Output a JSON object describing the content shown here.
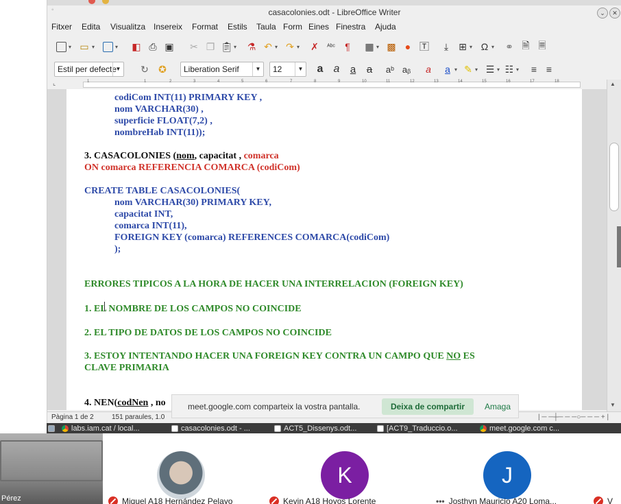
{
  "window": {
    "title": "casacolonies.odt - LibreOffice Writer"
  },
  "menu": [
    "Fitxer",
    "Edita",
    "Visualitza",
    "Insereix",
    "Format",
    "Estils",
    "Taula",
    "Form",
    "Eines",
    "Finestra",
    "Ajuda"
  ],
  "toolbar2": {
    "paragraph_style": "Estil per defecte",
    "font_name": "Liberation Serif",
    "font_size": "12"
  },
  "ruler_numbers": [
    "1",
    "1",
    "2",
    "3",
    "4",
    "5",
    "6",
    "7",
    "8",
    "9",
    "10",
    "11",
    "12",
    "13",
    "14",
    "15",
    "16",
    "17",
    "18"
  ],
  "document": {
    "line1": "codiCom INT(11) PRIMARY KEY ,",
    "line2": "nom VARCHAR(30) ,",
    "line3": "superficie FLOAT(7,2) ,",
    "line4": "nombreHab INT(11));",
    "sec3_prefix": "3. CASACOLONIES (",
    "sec3_pk": "nom",
    "sec3_rest": ", capacitat , ",
    "sec3_fk": "comarca",
    "sec3_on": "ON comarca REFERENCIA COMARCA (codiCom)",
    "create": "CREATE TABLE CASACOLONIES(",
    "c1": "nom VARCHAR(30) PRIMARY KEY,",
    "c2": "capacitat INT,",
    "c3": "comarca INT(11),",
    "c4": "FOREIGN KEY (comarca) REFERENCES COMARCA(codiCom)",
    "c5": ");",
    "errors_title": "ERRORES TIPICOS A LA HORA DE HACER UNA INTERRELACION (FOREIGN KEY)",
    "err1": "1. EL NOMBRE DE LOS CAMPOS NO COINCIDE",
    "err2": "2. EL TIPO DE DATOS DE LOS CAMPOS NO COINCIDE",
    "err3_a": "3. ESTOY INTENTANDO HACER UNA FOREIGN KEY CONTRA UN CAMPO QUE ",
    "err3_no": "NO",
    "err3_b": " ES",
    "err3_c": "CLAVE PRIMARIA",
    "sec4_prefix": "4. NEN(",
    "sec4_pk": "codNen",
    "sec4_rest": " , no"
  },
  "statusbar": {
    "page": "Pàgina 1 de 2",
    "words": "151 paraules, 1.0"
  },
  "share_notice": {
    "message": "meet.google.com comparteix la vostra pantalla.",
    "stop": "Deixa de compartir",
    "hide": "Amaga"
  },
  "taskbar": [
    {
      "label": "labs.iam.cat / local...",
      "icon": "chrome-icon"
    },
    {
      "label": "casacolonies.odt - ...",
      "icon": "document-icon"
    },
    {
      "label": "ACT5_Dissenys.odt...",
      "icon": "document-icon"
    },
    {
      "label": "[ACT9_Traduccio.o...",
      "icon": "document-icon"
    },
    {
      "label": "meet.google.com c...",
      "icon": "chrome-icon"
    }
  ],
  "participants": {
    "self_name": "Pérez",
    "p1": "Miquel A18 Hernández Pelayo",
    "p2": "Kevin A18 Hoyos Lorente",
    "p3": "Josthyn Mauricio A20 Loma...",
    "p4": "V",
    "avatar_k": "K",
    "avatar_j": "J"
  },
  "colors": {
    "sql_blue": "#2e4aa8",
    "fk_red": "#d0322a",
    "error_green": "#2f8a2a",
    "mic_off": "#d93025",
    "avatar_k": "#7b1fa2",
    "avatar_j": "#1565c0"
  }
}
